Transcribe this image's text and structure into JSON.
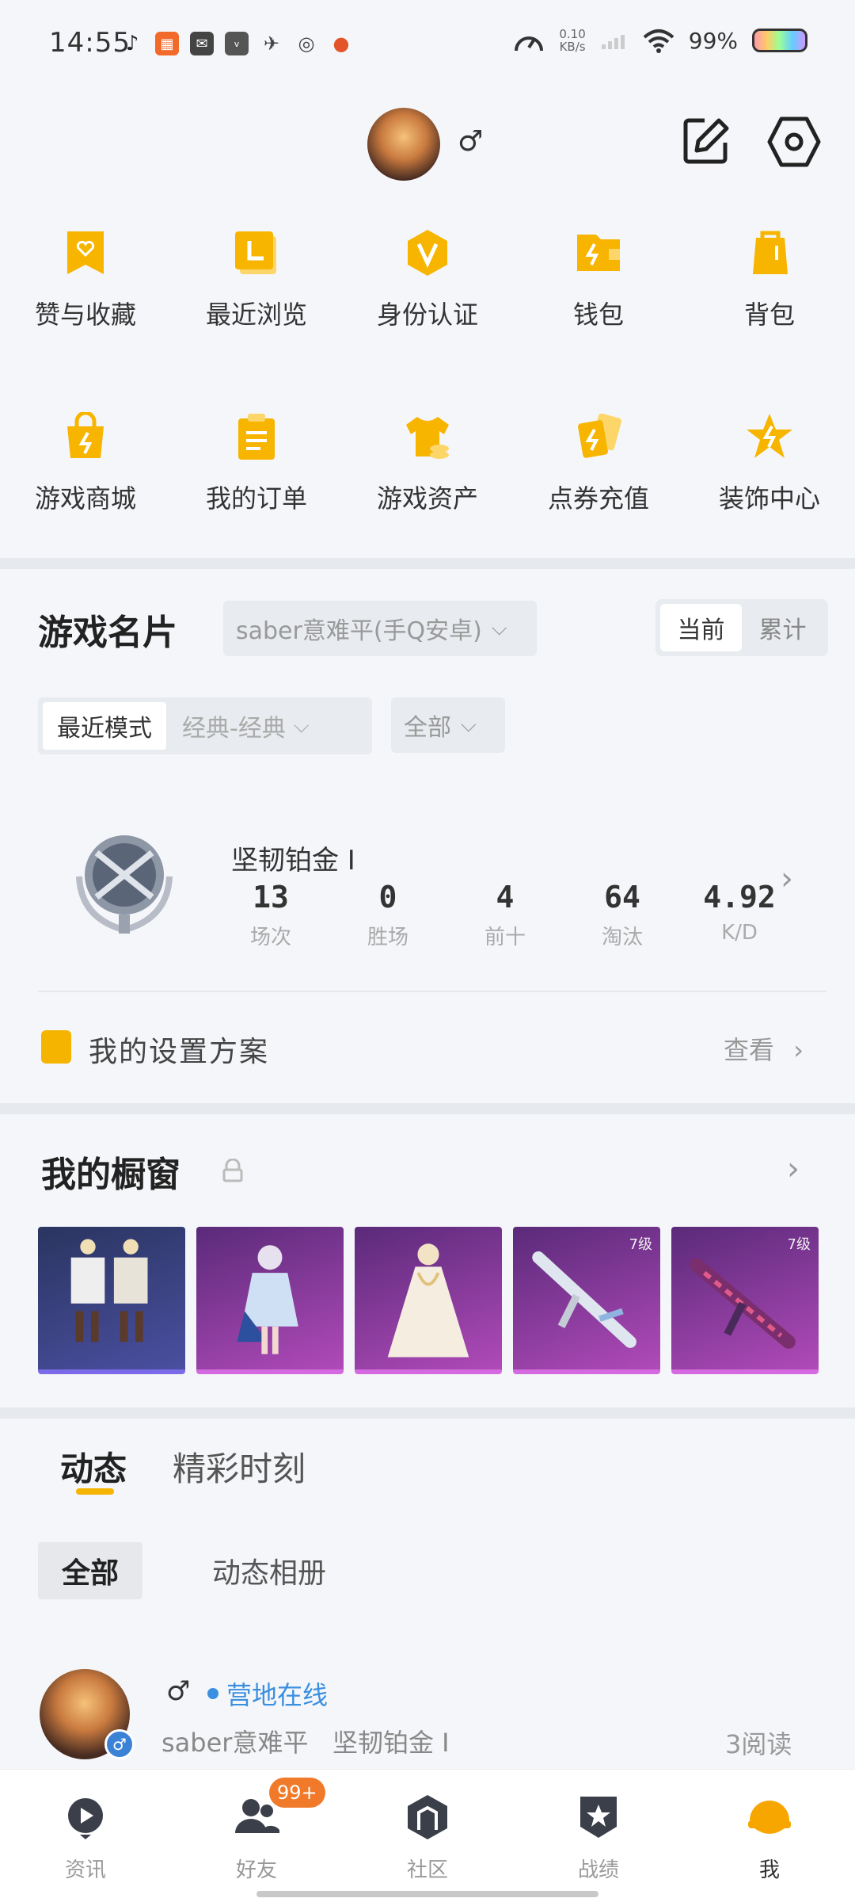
{
  "status_bar": {
    "time": "14:55",
    "net_speed_value": "0.10",
    "net_speed_unit": "KB/s",
    "battery": "99%"
  },
  "profile": {
    "gender_symbol": "♂"
  },
  "grid": {
    "row1": [
      {
        "label": "赞与收藏",
        "icon": "heart-bookmark-icon"
      },
      {
        "label": "最近浏览",
        "icon": "recent-folder-icon"
      },
      {
        "label": "身份认证",
        "icon": "verified-badge-icon"
      },
      {
        "label": "钱包",
        "icon": "wallet-icon"
      },
      {
        "label": "背包",
        "icon": "backpack-icon"
      }
    ],
    "row2": [
      {
        "label": "游戏商城",
        "icon": "shop-bag-icon"
      },
      {
        "label": "我的订单",
        "icon": "order-list-icon"
      },
      {
        "label": "游戏资产",
        "icon": "shirt-coin-icon"
      },
      {
        "label": "点券充值",
        "icon": "coupon-cards-icon"
      },
      {
        "label": "装饰中心",
        "icon": "star-decor-icon"
      }
    ]
  },
  "game_card": {
    "title": "游戏名片",
    "account_selector": "saber意难平(手Q安卓)",
    "segment": {
      "current": "当前",
      "total": "累计"
    },
    "mode_label": "最近模式",
    "mode_value": "经典-经典",
    "filter_value": "全部",
    "rank_name": "坚韧铂金 I",
    "stats": [
      {
        "value": "13",
        "label": "场次"
      },
      {
        "value": "0",
        "label": "胜场"
      },
      {
        "value": "4",
        "label": "前十"
      },
      {
        "value": "64",
        "label": "淘汰"
      },
      {
        "value": "4.92",
        "label": "K/D"
      }
    ],
    "settings_label": "我的设置方案",
    "settings_link": "查看"
  },
  "showcase": {
    "title": "我的橱窗",
    "items": [
      {
        "level": ""
      },
      {
        "level": ""
      },
      {
        "level": ""
      },
      {
        "level": "7级"
      },
      {
        "level": "7级"
      }
    ]
  },
  "feed": {
    "tabs": [
      "动态",
      "精彩时刻"
    ],
    "chips": [
      "全部",
      "动态相册"
    ],
    "post": {
      "gender_symbol": "♂",
      "status": "营地在线",
      "name": "saber意难平",
      "rank": "坚韧铂金 I",
      "reads": "3阅读"
    }
  },
  "bottom_nav": {
    "items": [
      {
        "label": "资讯",
        "icon": "news-play-icon"
      },
      {
        "label": "好友",
        "icon": "friends-icon"
      },
      {
        "label": "社区",
        "icon": "community-icon"
      },
      {
        "label": "战绩",
        "icon": "record-badge-icon"
      },
      {
        "label": "我",
        "icon": "me-helmet-icon"
      }
    ],
    "friends_badge": "99+"
  }
}
